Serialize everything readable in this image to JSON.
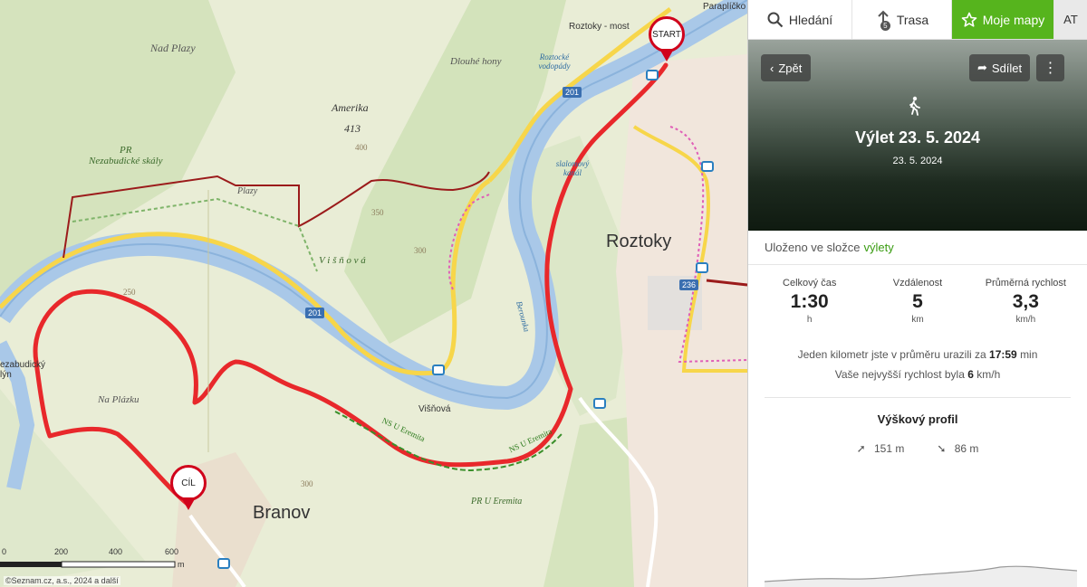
{
  "map": {
    "labels": {
      "nad_plazy": "Nad Plazy",
      "dlouhe_hony": "Dlouhé hony",
      "amerika": "Amerika",
      "amerika_alt": "413",
      "pr_nezabudicke": "PR\nNezabudické skály",
      "plazy": "Plazy",
      "visnova_area": "V i š ň o v á",
      "na_plazku": "Na Plázku",
      "visnova": "Višňová",
      "pr_u_eremita": "PR U Eremita",
      "ns_u_eremita_1": "NS U Eremita",
      "ns_u_eremita_2": "NS U Eremita",
      "roztoky_most": "Roztoky - most",
      "roztocke_vodopady": "Roztocké vodopády",
      "slalomovy_kanal": "slalomový kanál",
      "paraplicko": "Paraplíčko",
      "nezabudicky_mlyn": "ezabudický\nlýn",
      "berounka": "Berounka",
      "alt_400": "400",
      "alt_350": "350",
      "alt_300": "300",
      "alt_250": "250",
      "alt_300b": "300"
    },
    "towns": {
      "roztoky": "Roztoky",
      "branov": "Branov"
    },
    "roads": {
      "r201a": "201",
      "r201b": "201",
      "r236": "236"
    },
    "markers": {
      "start": "START",
      "finish": "CÍL"
    },
    "scale": {
      "s0": "0",
      "s200": "200",
      "s400": "400",
      "s600": "600",
      "unit": "m"
    },
    "copyright": "©Seznam.cz, a.s., 2024 a další"
  },
  "nav": {
    "search": "Hledání",
    "route": "Trasa",
    "route_badge": "5",
    "my_maps": "Moje mapy",
    "avatar": "AT"
  },
  "trip": {
    "back": "Zpět",
    "share": "Sdílet",
    "title": "Výlet 23. 5. 2024",
    "date": "23. 5. 2024",
    "folder_prefix": "Uloženo ve složce",
    "folder_name": "výlety"
  },
  "stats": {
    "time": {
      "label": "Celkový čas",
      "value": "1:30",
      "unit": "h"
    },
    "distance": {
      "label": "Vzdálenost",
      "value": "5",
      "unit": "km"
    },
    "speed": {
      "label": "Průměrná rychlost",
      "value": "3,3",
      "unit": "km/h"
    }
  },
  "info": {
    "pace_prefix": "Jeden kilometr jste v průměru urazili za",
    "pace_value": "17:59",
    "pace_unit": "min",
    "max_prefix": "Vaše nejvyšší rychlost byla",
    "max_value": "6",
    "max_unit": "km/h"
  },
  "elevation": {
    "title": "Výškový profil",
    "ascent": "151 m",
    "descent": "86 m"
  },
  "colors": {
    "accent": "#56b41d",
    "route": "#e8282b",
    "river": "#a9c8e8"
  }
}
